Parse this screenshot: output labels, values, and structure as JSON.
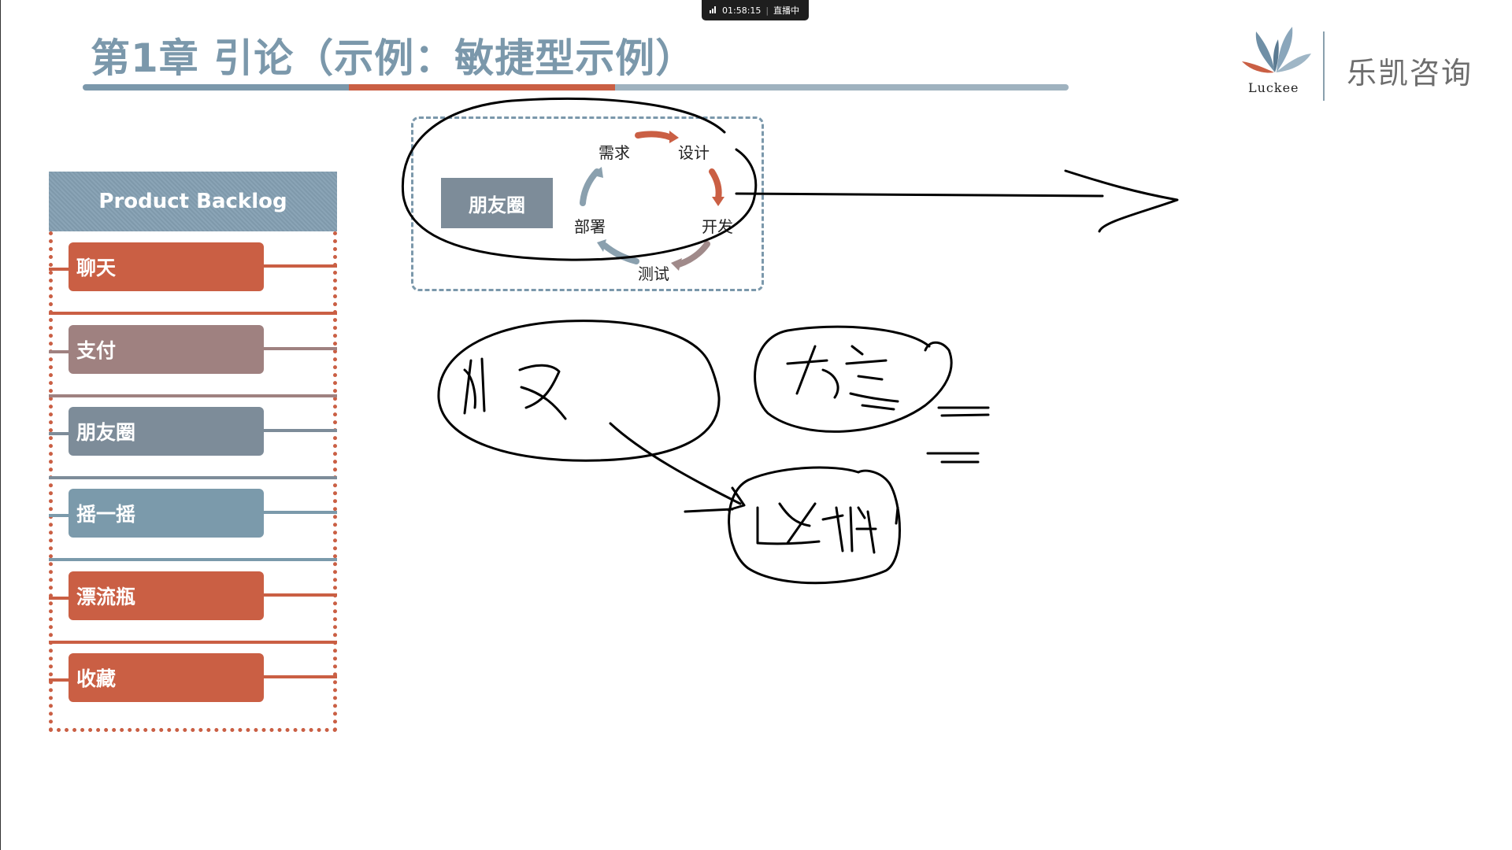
{
  "status_bar": {
    "time": "01:58:15",
    "live_label": "直播中"
  },
  "slide": {
    "title": "第1章 引论（示例：敏捷型示例）"
  },
  "logo": {
    "brand_en": "Luckee",
    "brand_cn": "乐凯咨询"
  },
  "backlog": {
    "header": "Product Backlog",
    "items": [
      {
        "label": "聊天",
        "color": "#ca5f44"
      },
      {
        "label": "支付",
        "color": "#9f8180"
      },
      {
        "label": "朋友圈",
        "color": "#7d8c99"
      },
      {
        "label": "摇一摇",
        "color": "#7b9aab"
      },
      {
        "label": "漂流瓶",
        "color": "#ca5f44"
      },
      {
        "label": "收藏",
        "color": "#ca5f44"
      }
    ]
  },
  "sprint": {
    "story": "朋友圈",
    "cycle": {
      "requirements": "需求",
      "design": "设计",
      "develop": "开发",
      "test": "测试",
      "deploy": "部署"
    }
  },
  "colors": {
    "primary": "#7b98ab",
    "accent": "#ca5f44"
  }
}
